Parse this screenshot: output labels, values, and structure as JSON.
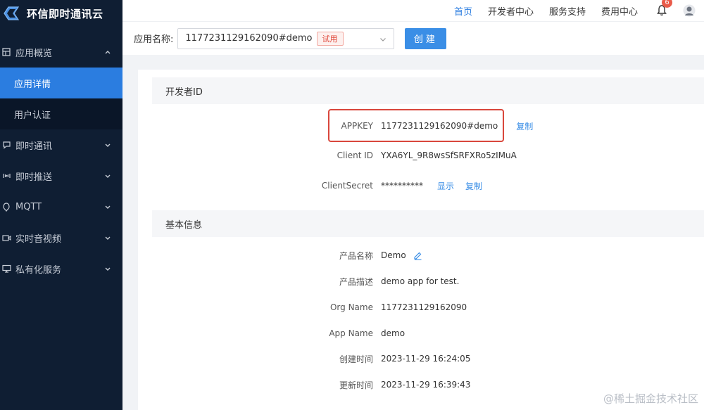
{
  "brand": {
    "name": "环信即时通讯云"
  },
  "sidebar": {
    "items": [
      {
        "label": "应用概览",
        "icon": "grid-icon",
        "expanded": true,
        "children": [
          {
            "label": "应用详情",
            "active": true
          },
          {
            "label": "用户认证",
            "active": false
          }
        ]
      },
      {
        "label": "即时通讯",
        "icon": "chat-icon"
      },
      {
        "label": "即时推送",
        "icon": "broadcast-icon"
      },
      {
        "label": "MQTT",
        "icon": "mqtt-icon"
      },
      {
        "label": "实时音视频",
        "icon": "video-icon"
      },
      {
        "label": "私有化服务",
        "icon": "monitor-icon"
      }
    ]
  },
  "topnav": {
    "items": [
      "首页",
      "开发者中心",
      "服务支持",
      "费用中心"
    ],
    "active_index": 0,
    "notifications": "6"
  },
  "appbar": {
    "label": "应用名称:",
    "selected_app": "1177231129162090#demo",
    "tag": "试用",
    "create_label": "创建"
  },
  "developer": {
    "section_title": "开发者ID",
    "appkey_label": "APPKEY",
    "appkey_value": "1177231129162090#demo",
    "copy_label": "复制",
    "client_id_label": "Client ID",
    "client_id_value": "YXA6YL_9R8wsSfSRFXRo5zIMuA",
    "client_secret_label": "ClientSecret",
    "client_secret_value": "**********",
    "show_label": "显示"
  },
  "basic": {
    "section_title": "基本信息",
    "product_name_label": "产品名称",
    "product_name_value": "Demo",
    "product_desc_label": "产品描述",
    "product_desc_value": "demo app for test.",
    "org_name_label": "Org Name",
    "org_name_value": "1177231129162090",
    "app_name_label": "App Name",
    "app_name_value": "demo",
    "created_label": "创建时间",
    "created_value": "2023-11-29 16:24:05",
    "updated_label": "更新时间",
    "updated_value": "2023-11-29 16:39:43"
  },
  "watermark": "@稀土掘金技术社区",
  "colors": {
    "sidebar_bg": "#0f1e33",
    "accent": "#2b7de0",
    "highlight_border": "#d9473c",
    "trial_tag": "#e0473a"
  }
}
